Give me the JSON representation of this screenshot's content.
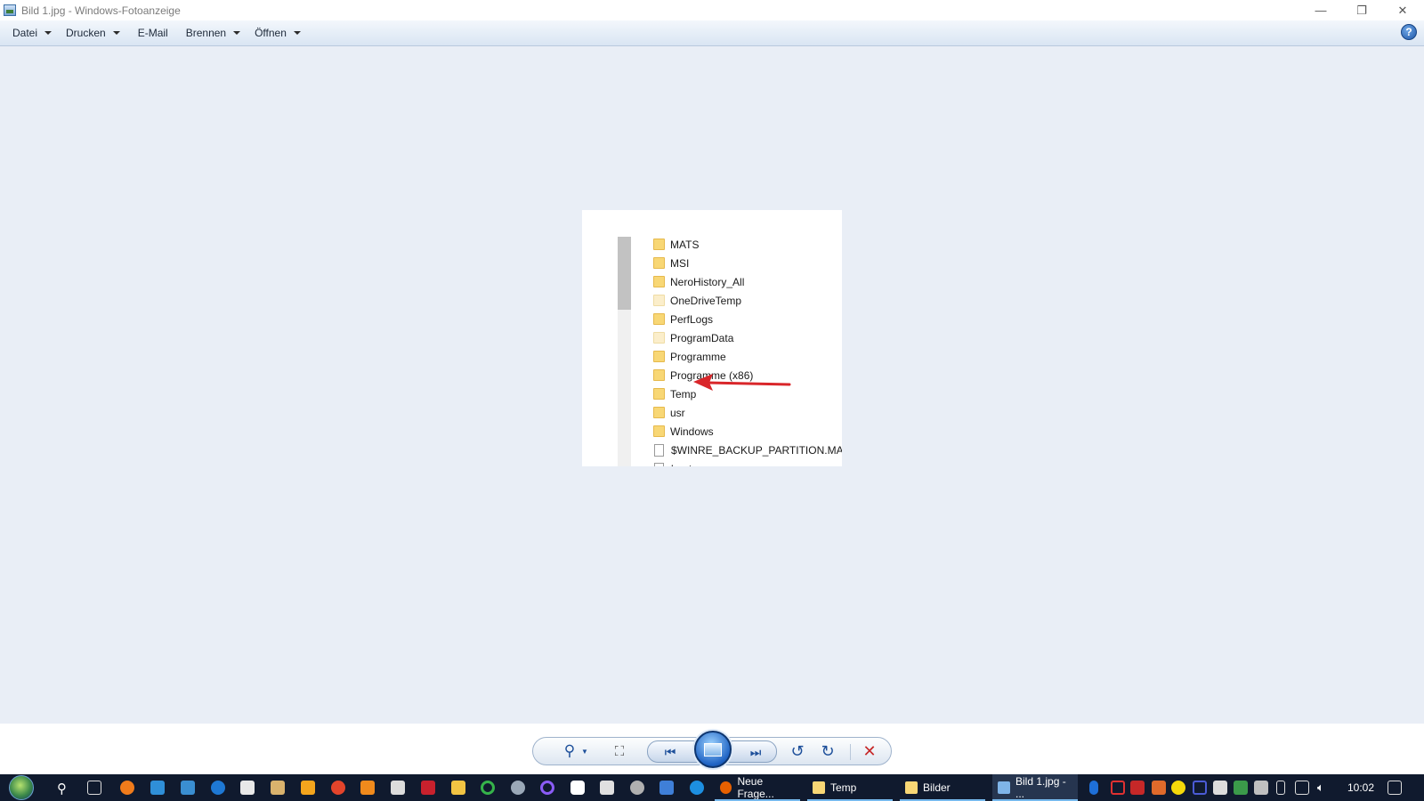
{
  "window": {
    "title": "Bild 1.jpg - Windows-Fotoanzeige",
    "minimize_glyph": "—",
    "restore_glyph": "❐",
    "close_glyph": "✕"
  },
  "menu": {
    "items": [
      {
        "label": "Datei",
        "has_dropdown": true
      },
      {
        "label": "Drucken",
        "has_dropdown": true
      },
      {
        "label": "E-Mail",
        "has_dropdown": false
      },
      {
        "label": "Brennen",
        "has_dropdown": true
      },
      {
        "label": "Öffnen",
        "has_dropdown": true
      }
    ],
    "help_glyph": "?"
  },
  "photo": {
    "files": [
      {
        "name": "MATS",
        "type": "folder"
      },
      {
        "name": "MSI",
        "type": "folder"
      },
      {
        "name": "NeroHistory_All",
        "type": "folder"
      },
      {
        "name": "OneDriveTemp",
        "type": "folder-light"
      },
      {
        "name": "PerfLogs",
        "type": "folder"
      },
      {
        "name": "ProgramData",
        "type": "folder-light"
      },
      {
        "name": "Programme",
        "type": "folder"
      },
      {
        "name": "Programme (x86)",
        "type": "folder"
      },
      {
        "name": "Temp",
        "type": "folder"
      },
      {
        "name": "usr",
        "type": "folder"
      },
      {
        "name": "Windows",
        "type": "folder"
      },
      {
        "name": "$WINRE_BACKUP_PARTITION.MARKER",
        "type": "file"
      },
      {
        "name": "bootmgr",
        "type": "file"
      }
    ],
    "arrow_color": "#d9262a"
  },
  "controls": {
    "zoom_glyph": "⚲",
    "fit_glyph": "⛶",
    "prev_glyph": "⏮",
    "next_glyph": "⏭",
    "rotate_left_glyph": "↺",
    "rotate_right_glyph": "↻",
    "delete_glyph": "✕",
    "delete_color": "#c62828"
  },
  "taskbar": {
    "tasks": [
      {
        "label": "Neue Frage...",
        "icon": "firefox-icon",
        "color": "#e66000"
      },
      {
        "label": "Temp",
        "icon": "folder-icon",
        "color": "#f8d775"
      },
      {
        "label": "Bilder",
        "icon": "folder-icon",
        "color": "#f8d775"
      },
      {
        "label": "Bild 1.jpg - ...",
        "icon": "photo-viewer-icon",
        "color": "#7fb4e8"
      }
    ],
    "clock": "10:02"
  }
}
